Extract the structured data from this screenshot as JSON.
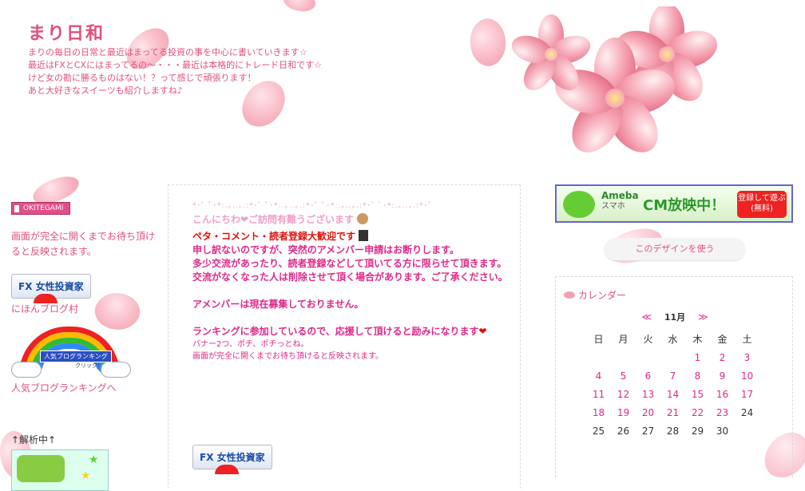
{
  "header": {
    "title": "まり日和",
    "description": [
      "まりの毎日の日常と最近はまってる投資の事を中心に書いていきます☆",
      "最近はFXとCXにはまってるの〜・・・最近は本格的にトレード日和です☆",
      "けど女の勘に勝るものはない！？って感じで頑張ります！",
      "あと大好きなスイーツも紹介しますね♪"
    ]
  },
  "left": {
    "okitegami_label": "OKITEGAMI",
    "note": "画面が完全に開くまでお待ち頂けると反映されます。",
    "fx_banner": "FX 女性投資家",
    "nihon_blog": "にほんブログ村",
    "rank_banner_label": "人気ブログランキング",
    "rank_banner_click": "クリック！",
    "rank_link": "人気ブログランキングへ",
    "kaiseki": "↑解析中↑"
  },
  "center": {
    "deco": "*･゜ﾟ･*:.｡..｡.:*･゜ﾟ･*:.｡..｡.:*･゜ﾟ･*:.｡..｡.:*･゜ﾟ･*:.｡..｡.:*･゜",
    "greeting": "こんにちわ❤ご訪問有難うございます",
    "welcome": "ペタ・コメント・読者登録大歓迎です",
    "line1": "申し訳ないのですが、突然のアメンバー申請はお断りします。",
    "line2": "多少交流があったり、読者登録などして頂いてる方に限らせて頂きます。",
    "line3": "交流がなくなった人は削除させて頂く場合があります。ご了承ください。",
    "line4": "アメンバーは現在募集しておりません。",
    "line5": "ランキングに参加しているので、応援して頂けると励みになります",
    "small1": "バナー2つ、ポチ、ポチっとね。",
    "small2": "画面が完全に開くまでお待ち頂けると反映されます。",
    "fx_banner": "FX 女性投資家"
  },
  "right": {
    "ameba_brand": "Ameba",
    "ameba_sub": "スマホ",
    "ameba_cm": "CM放映中！",
    "ameba_btn": "登録して遊ぶ(無料)",
    "use_design": "このデザインを使う",
    "calendar": {
      "title": "カレンダー",
      "prev": "≪",
      "next": "≫",
      "month": "11月",
      "weekdays": [
        "日",
        "月",
        "火",
        "水",
        "木",
        "金",
        "土"
      ],
      "weeks": [
        [
          "",
          "",
          "",
          "",
          "1",
          "2",
          "3"
        ],
        [
          "4",
          "5",
          "6",
          "7",
          "8",
          "9",
          "10"
        ],
        [
          "11",
          "12",
          "13",
          "14",
          "15",
          "16",
          "17"
        ],
        [
          "18",
          "19",
          "20",
          "21",
          "22",
          "23",
          "24"
        ],
        [
          "25",
          "26",
          "27",
          "28",
          "29",
          "30",
          ""
        ]
      ],
      "linked_days": [
        "1",
        "2",
        "3",
        "4",
        "5",
        "6",
        "7",
        "8",
        "9",
        "10",
        "11",
        "12",
        "13",
        "14",
        "15",
        "16",
        "17",
        "18",
        "19",
        "20",
        "21",
        "22",
        "23"
      ]
    }
  },
  "colors": {
    "accent": "#e2507a",
    "strong": "#e0288a",
    "red": "#e0100a"
  }
}
